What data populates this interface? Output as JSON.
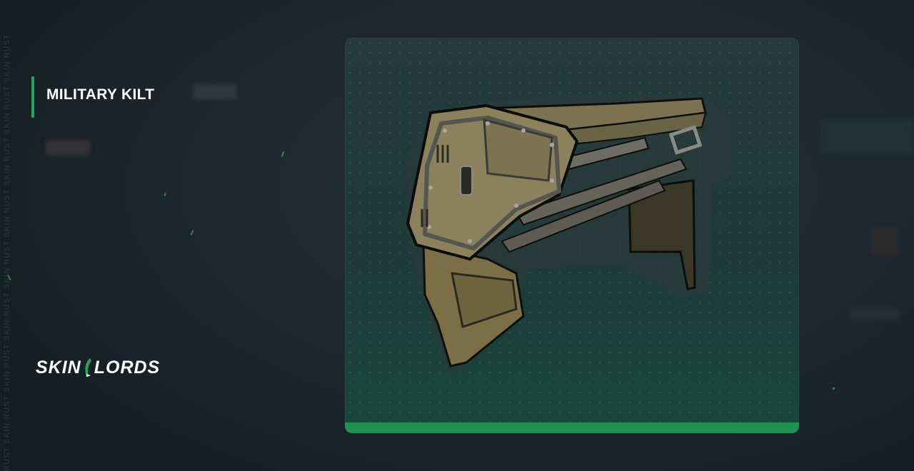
{
  "item": {
    "name": "MILITARY KILT"
  },
  "brand": {
    "logo_text_left": "SKIN",
    "logo_text_right": "LORDS"
  },
  "background": {
    "watermark": "RUST SKIN RUST SKIN RUST SKIN RUST SKIN RUST SKIN RUST SKIN RUST SKIN RUST SKIN RUST"
  },
  "colors": {
    "accent": "#1faa5a",
    "card_bottom": "#1f9150",
    "background": "#1c252c"
  }
}
